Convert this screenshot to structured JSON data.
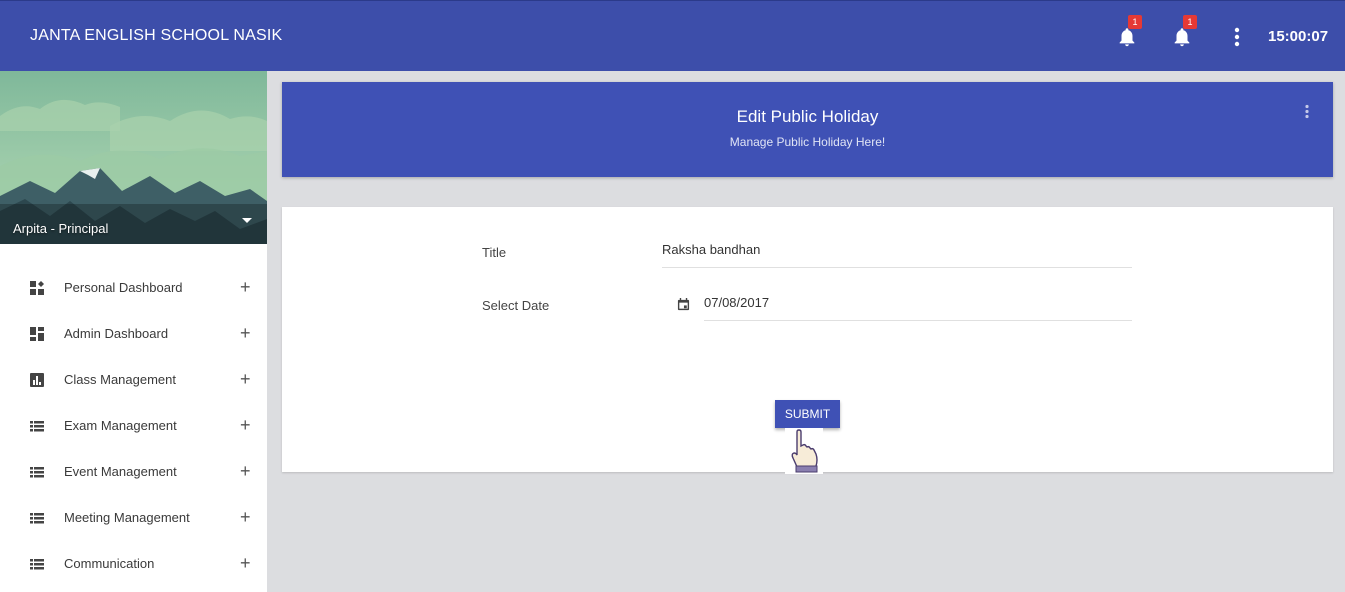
{
  "app": {
    "title": "JANTA ENGLISH SCHOOL NASIK",
    "clock": "15:00:07"
  },
  "topbar": {
    "notifications": [
      {
        "icon": "bell-icon",
        "count": "1"
      },
      {
        "icon": "bell-icon",
        "count": "1"
      }
    ],
    "menu_icon": "more-vert-icon"
  },
  "sidebar": {
    "profile": {
      "name": "Arpita - Principal"
    },
    "items": [
      {
        "label": "Personal Dashboard",
        "icon": "dashboard-customize-icon"
      },
      {
        "label": "Admin Dashboard",
        "icon": "dashboard-icon"
      },
      {
        "label": "Class Management",
        "icon": "chart-icon"
      },
      {
        "label": "Exam Management",
        "icon": "list-icon"
      },
      {
        "label": "Event Management",
        "icon": "list-icon"
      },
      {
        "label": "Meeting Management",
        "icon": "list-icon"
      },
      {
        "label": "Communication",
        "icon": "list-icon"
      }
    ],
    "expand_symbol": "+"
  },
  "header": {
    "title": "Edit Public Holiday",
    "subtitle": "Manage Public Holiday Here!"
  },
  "form": {
    "title_label": "Title",
    "title_value": "Raksha bandhan",
    "date_label": "Select Date",
    "date_value": "07/08/2017",
    "submit_label": "SUBMIT"
  },
  "colors": {
    "primary": "#3f51b5",
    "topbar": "#3d4eaa",
    "badge": "#e53935",
    "background": "#dcdde0"
  }
}
